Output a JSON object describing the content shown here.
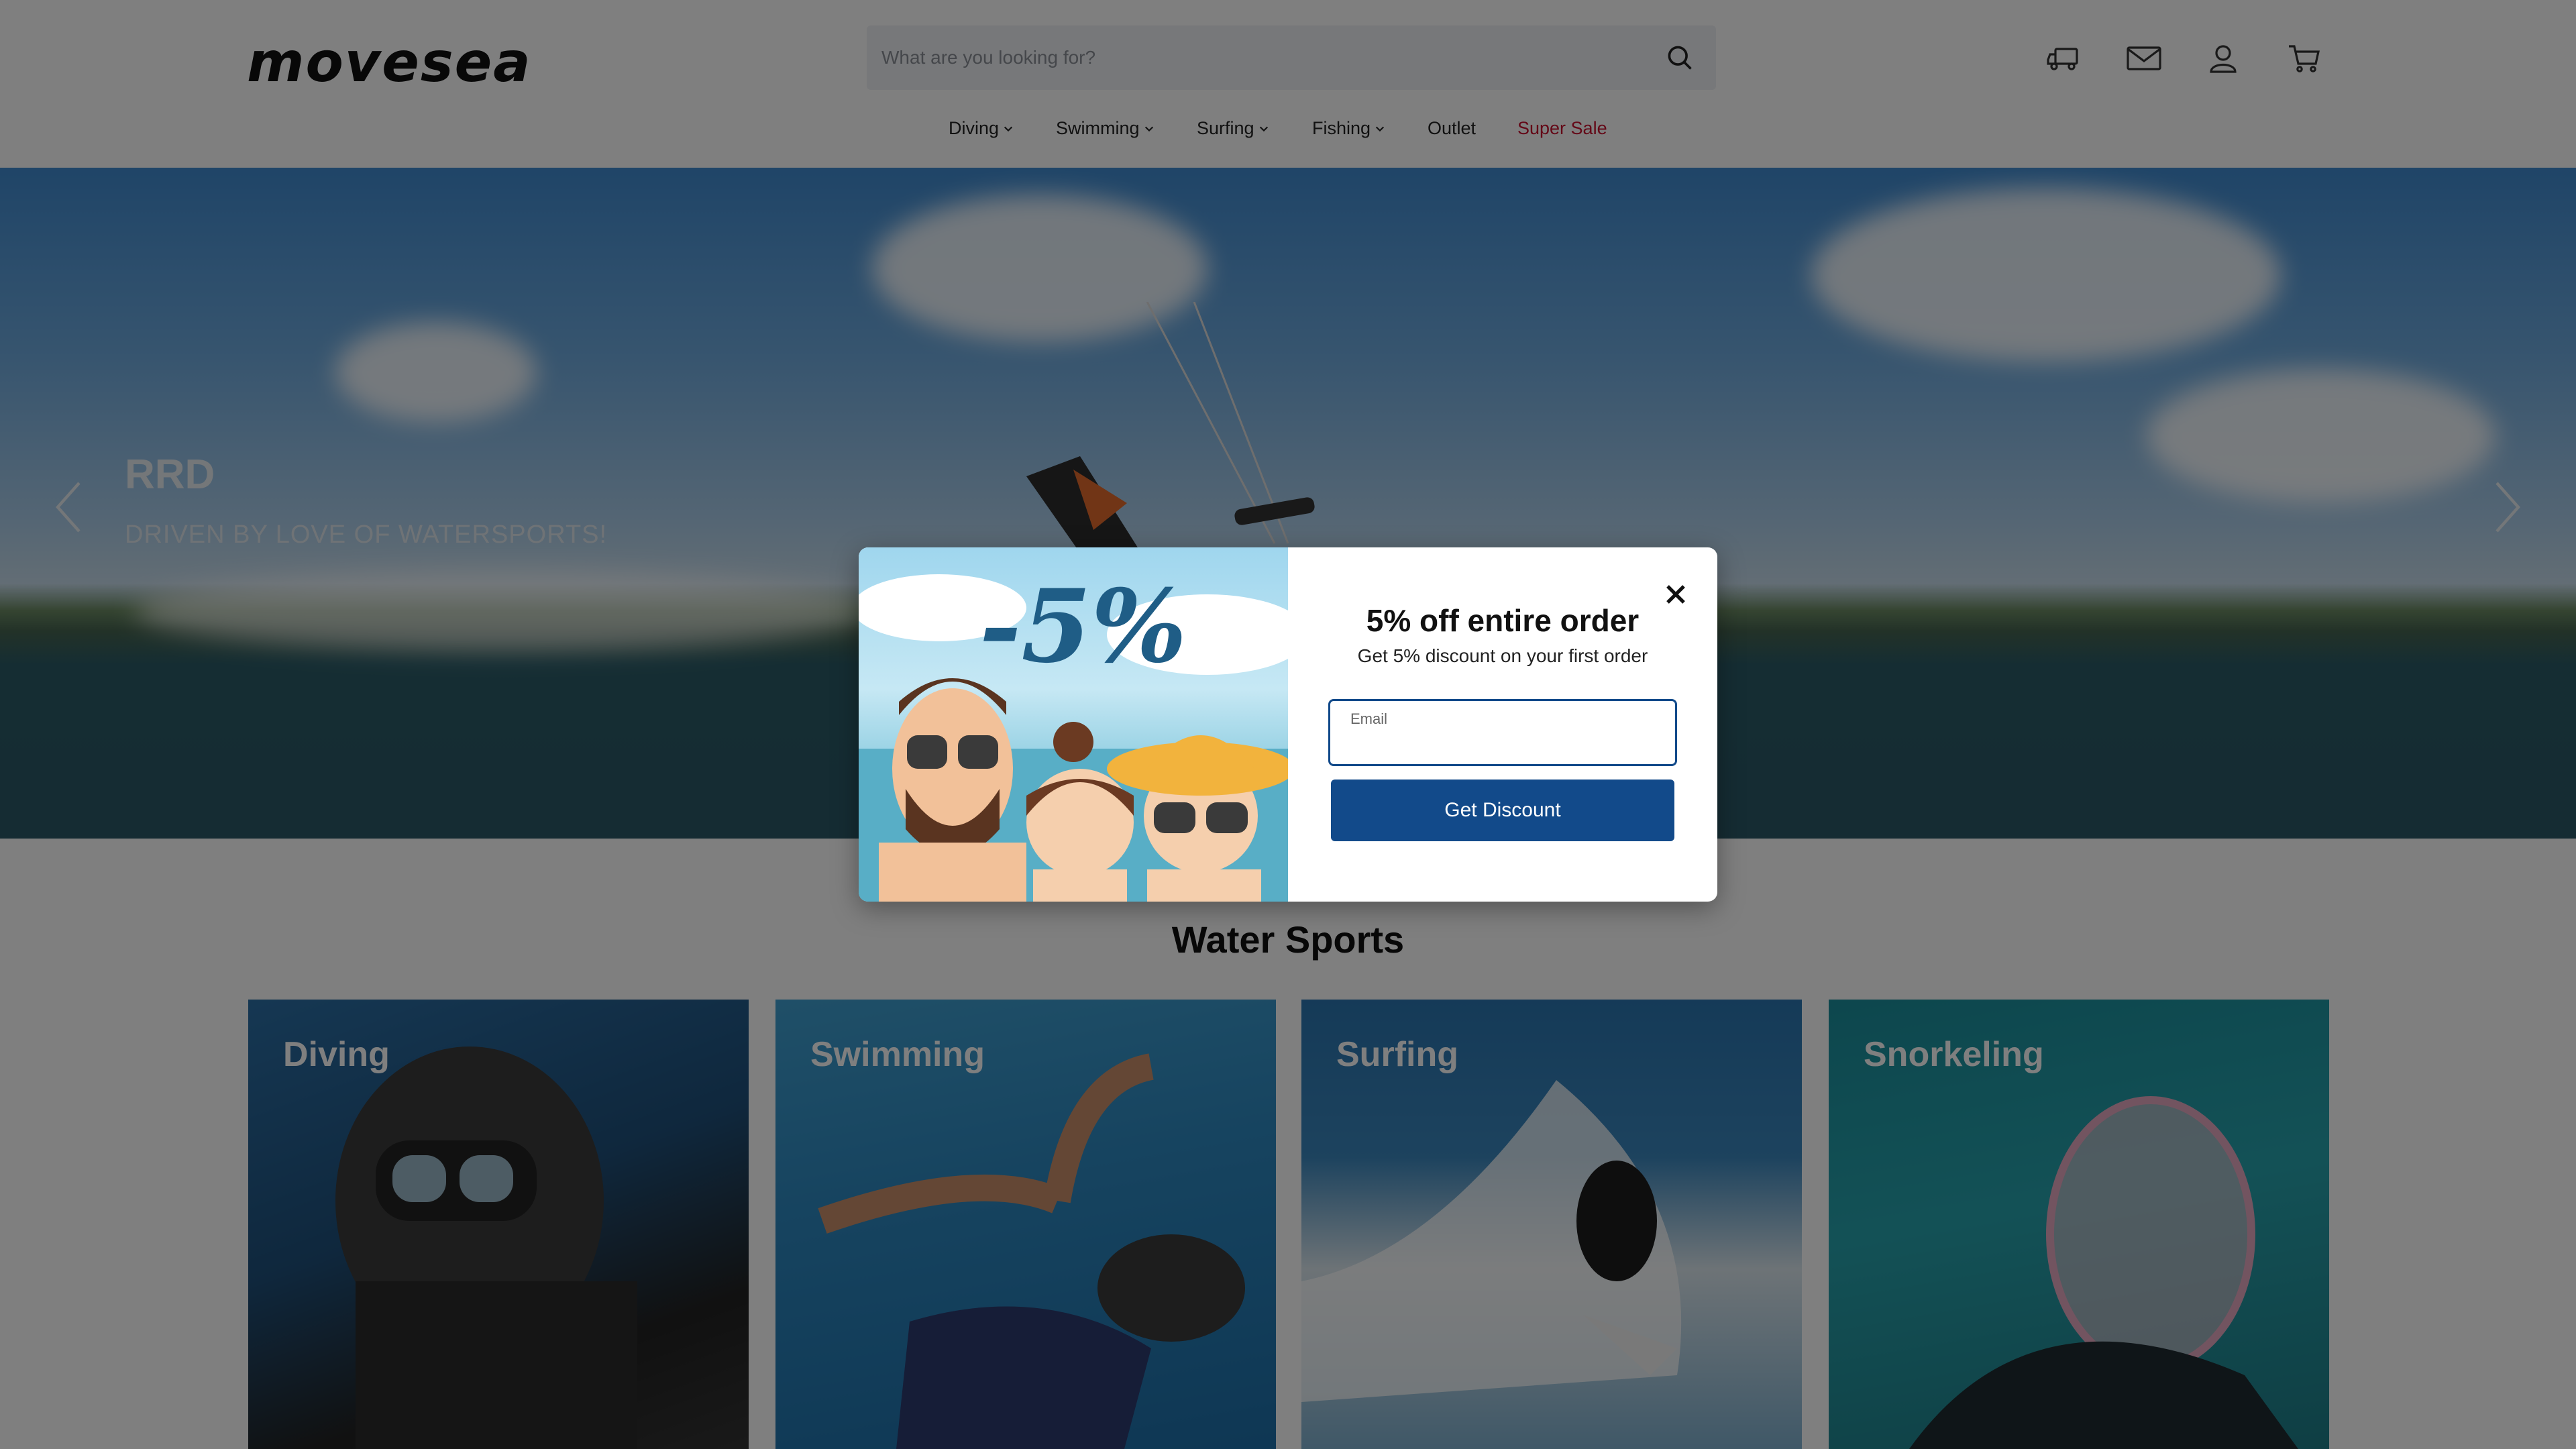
{
  "header": {
    "logo": "movesea",
    "search_placeholder": "What are you looking for?",
    "icons": [
      "truck-icon",
      "mail-icon",
      "user-icon",
      "cart-icon"
    ]
  },
  "nav": {
    "items": [
      {
        "label": "Diving",
        "has_dropdown": true
      },
      {
        "label": "Swimming",
        "has_dropdown": true
      },
      {
        "label": "Surfing",
        "has_dropdown": true
      },
      {
        "label": "Fishing",
        "has_dropdown": true
      },
      {
        "label": "Outlet",
        "has_dropdown": false
      },
      {
        "label": "Super Sale",
        "has_dropdown": false
      }
    ],
    "sale_color": "#c8102e"
  },
  "hero": {
    "title": "RRD",
    "subtitle": "DRIVEN BY LOVE OF WATERSPORTS!"
  },
  "section": {
    "title": "Water Sports",
    "cards": [
      {
        "label": "Diving"
      },
      {
        "label": "Swimming"
      },
      {
        "label": "Surfing"
      },
      {
        "label": "Snorkeling"
      }
    ]
  },
  "modal": {
    "badge": "-5%",
    "title": "5% off entire order",
    "subtitle": "Get 5% discount on your first order",
    "email_label": "Email",
    "button_label": "Get Discount",
    "accent_color": "#124a8a"
  }
}
